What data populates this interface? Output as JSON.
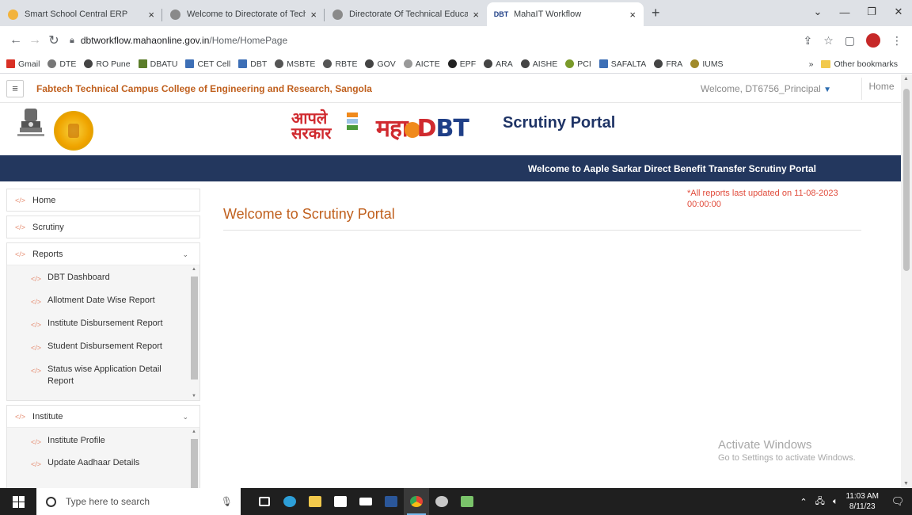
{
  "browser": {
    "tabs": [
      {
        "label": "Smart School Central ERP",
        "color": "#f2b33d"
      },
      {
        "label": "Welcome to Directorate of Techn",
        "color": "#6b6b6b"
      },
      {
        "label": "Directorate Of Technical Educatic",
        "color": "#6b6b6b"
      },
      {
        "label": "MahaIT Workflow",
        "color": "#1f3f87",
        "active": true
      }
    ],
    "url_host": "dbtworkflow.mahaonline.gov.in",
    "url_path": "/Home/HomePage",
    "bookmarks": [
      {
        "label": "Gmail",
        "color": "#d93025"
      },
      {
        "label": "DTE",
        "color": "#777"
      },
      {
        "label": "RO Pune",
        "color": "#444"
      },
      {
        "label": "DBATU",
        "color": "#5b7d2a"
      },
      {
        "label": "CET Cell",
        "color": "#3d6fb6"
      },
      {
        "label": "DBT",
        "color": "#3d6fb6"
      },
      {
        "label": "MSBTE",
        "color": "#555"
      },
      {
        "label": "RBTE",
        "color": "#555"
      },
      {
        "label": "GOV",
        "color": "#444"
      },
      {
        "label": "AICTE",
        "color": "#999"
      },
      {
        "label": "EPF",
        "color": "#222"
      },
      {
        "label": "ARA",
        "color": "#444"
      },
      {
        "label": "AISHE",
        "color": "#444"
      },
      {
        "label": "PCI",
        "color": "#7a9a2a"
      },
      {
        "label": "SAFALTA",
        "color": "#3d6fb6"
      },
      {
        "label": "FRA",
        "color": "#444"
      },
      {
        "label": "IUMS",
        "color": "#a08a2a"
      }
    ],
    "more_bookmarks": "»",
    "other_bookmarks": "Other bookmarks"
  },
  "page": {
    "college_name": "Fabtech Technical Campus College of Engineering and Research, Sangola",
    "welcome_user": "Welcome, DT6756_Principal",
    "home_link": "Home",
    "logo_aaple_line1": "आपले",
    "logo_aaple_line2": "सरकार",
    "logo_maha": "महा",
    "logo_dbt_d": "D",
    "logo_dbt_bt": "BT",
    "portal_title": "Scrutiny Portal",
    "banner": "Welcome to Aaple Sarkar Direct Benefit Transfer Scrutiny Portal",
    "main_title": "Welcome to Scrutiny Portal",
    "update_note": "*All reports last updated on 11-08-2023 00:00:00"
  },
  "sidebar": {
    "home": "Home",
    "scrutiny": "Scrutiny",
    "reports": {
      "label": "Reports",
      "items": [
        "DBT Dashboard",
        "Allotment Date Wise Report",
        "Institute Disbursement Report",
        "Student Disbursement Report",
        "Status wise Application Detail Report"
      ]
    },
    "institute": {
      "label": "Institute",
      "items": [
        "Institute Profile",
        "Update Aadhaar Details"
      ]
    }
  },
  "watermark": {
    "line1": "Activate Windows",
    "line2": "Go to Settings to activate Windows."
  },
  "taskbar": {
    "search_placeholder": "Type here to search",
    "time": "11:03 AM",
    "date": "8/11/23",
    "apps": [
      {
        "name": "task-view",
        "color": "#ffffff"
      },
      {
        "name": "edge",
        "color": "#2d9fd8"
      },
      {
        "name": "file-explorer",
        "color": "#f2c94c"
      },
      {
        "name": "store",
        "color": "#ffffff"
      },
      {
        "name": "mail",
        "color": "#ffffff"
      },
      {
        "name": "word",
        "color": "#2b579a"
      },
      {
        "name": "chrome",
        "color": "#e54335",
        "active": true
      },
      {
        "name": "paint",
        "color": "#c8c8c8"
      },
      {
        "name": "excel",
        "color": "#7ac36a"
      }
    ]
  }
}
